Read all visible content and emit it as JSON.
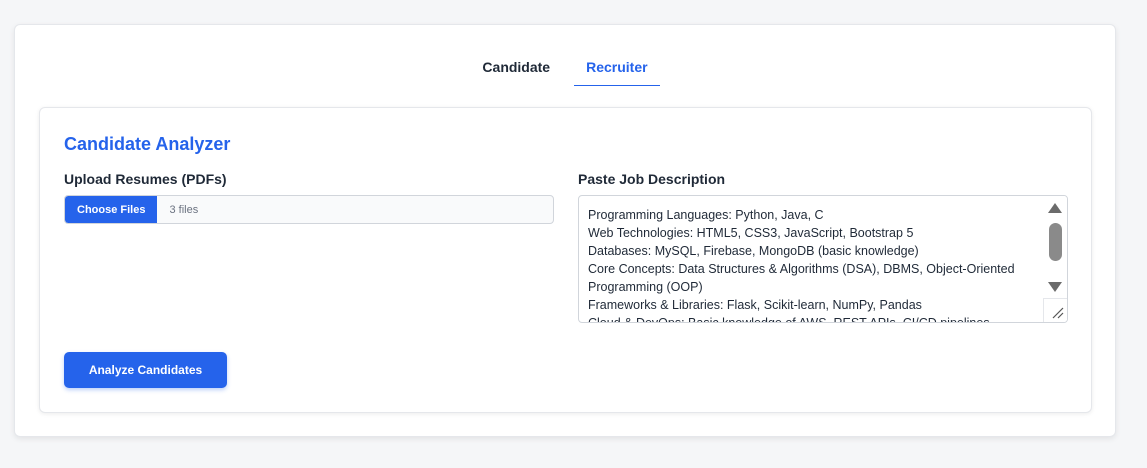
{
  "tabs": [
    {
      "label": "Candidate",
      "active": false
    },
    {
      "label": "Recruiter",
      "active": true
    }
  ],
  "panel": {
    "title": "Candidate Analyzer",
    "upload_label": "Upload Resumes (PDFs)",
    "file_button_label": "Choose Files",
    "file_status": "3 files",
    "jd_label": "Paste Job Description",
    "jd_lines": [
      "Programming Languages: Python, Java, C",
      "Web Technologies: HTML5, CSS3, JavaScript, Bootstrap 5",
      "Databases: MySQL, Firebase, MongoDB (basic knowledge)",
      "Core Concepts: Data Structures & Algorithms (DSA), DBMS, Object-Oriented Programming (OOP)",
      "Frameworks & Libraries: Flask, Scikit-learn, NumPy, Pandas",
      "Cloud & DevOps: Basic knowledge of AWS, REST APIs, CI/CD pipelines"
    ],
    "analyze_button_label": "Analyze Candidates"
  },
  "colors": {
    "accent": "#2563eb",
    "text": "#1f2937",
    "muted": "#6b7280"
  }
}
